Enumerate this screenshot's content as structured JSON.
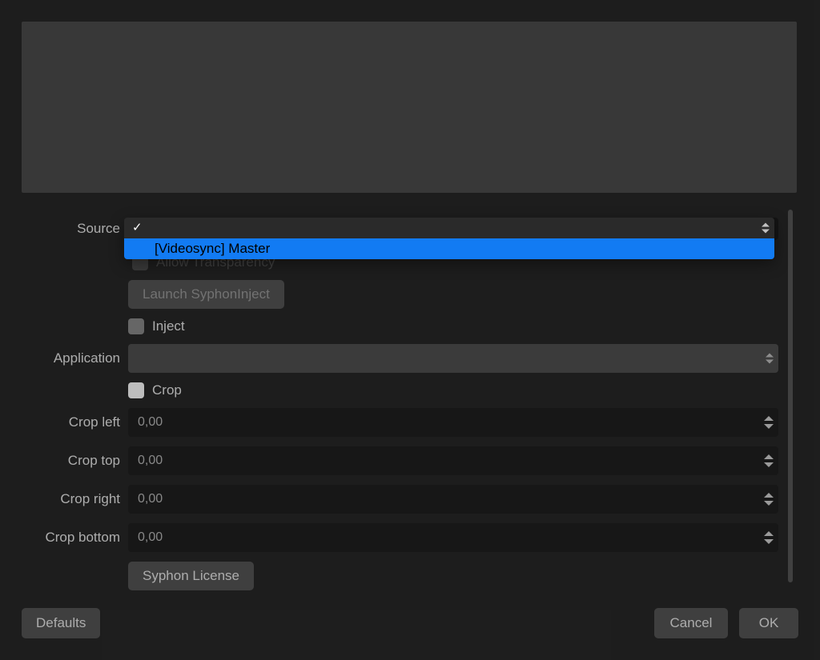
{
  "form": {
    "source_label": "Source",
    "allow_transparency_label": "Allow Transparency",
    "launch_syphoninject_label": "Launch SyphonInject",
    "inject_label": "Inject",
    "application_label": "Application",
    "application_value": "",
    "crop_label": "Crop",
    "crop_checked": true,
    "crop_left_label": "Crop left",
    "crop_left_value": "0,00",
    "crop_top_label": "Crop top",
    "crop_top_value": "0,00",
    "crop_right_label": "Crop right",
    "crop_right_value": "0,00",
    "crop_bottom_label": "Crop bottom",
    "crop_bottom_value": "0,00",
    "syphon_license_label": "Syphon License"
  },
  "source_dropdown": {
    "selected_index": 0,
    "items": [
      {
        "label": "",
        "checked": true
      },
      {
        "label": "[Videosync] Master",
        "highlighted": true
      }
    ]
  },
  "dialog": {
    "defaults_label": "Defaults",
    "cancel_label": "Cancel",
    "ok_label": "OK"
  }
}
